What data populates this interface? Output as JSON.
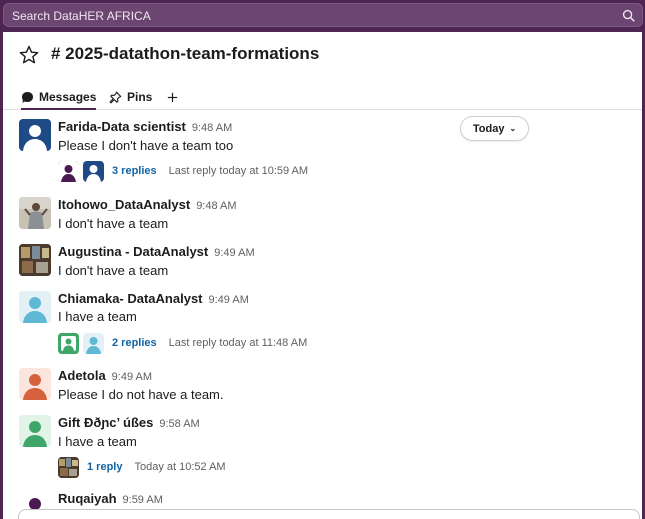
{
  "search": {
    "placeholder": "Search DataHER AFRICA"
  },
  "channel": {
    "title": "# 2025-datathon-team-formations"
  },
  "tabs": [
    {
      "label": "Messages",
      "icon": "speech-bubble-icon"
    },
    {
      "label": "Pins",
      "icon": "pin-icon"
    },
    {
      "label": "+",
      "icon": "plus-icon"
    }
  ],
  "date_divider": {
    "label": "Today"
  },
  "messages": [
    {
      "name": "Farida-Data scientist",
      "time": "9:48 AM",
      "text": "Please I don't have a team too",
      "thread": {
        "replies": "3 replies",
        "last": "Last reply today at 10:59 AM"
      }
    },
    {
      "name": "Itohowo_DataAnalyst",
      "time": "9:48 AM",
      "text": "I don't have a team"
    },
    {
      "name": "Augustina - DataAnalyst",
      "time": "9:49 AM",
      "text": "I don't have a team"
    },
    {
      "name": "Chiamaka- DataAnalyst",
      "time": "9:49 AM",
      "text": "I have a team",
      "thread": {
        "replies": "2 replies",
        "last": "Last reply today at 11:48 AM"
      }
    },
    {
      "name": "Adetola",
      "time": "9:49 AM",
      "text": "Please I do not have a team."
    },
    {
      "name": "Gift Ððɲc’ úßes",
      "time": "9:58 AM",
      "text": "I have a team",
      "thread": {
        "replies": "1 reply",
        "last": "Today at 10:52 AM"
      }
    },
    {
      "name": "Ruqaiyah",
      "time": "9:59 AM",
      "text": ""
    }
  ],
  "colors": {
    "aubergine": "#4f2653",
    "link": "#1264a3",
    "avatar_teal": "#5fb8d4",
    "avatar_orange": "#d5613f",
    "avatar_green": "#3fa66a",
    "avatar_navy": "#1e4a86",
    "avatar_purple": "#4b1a51"
  }
}
